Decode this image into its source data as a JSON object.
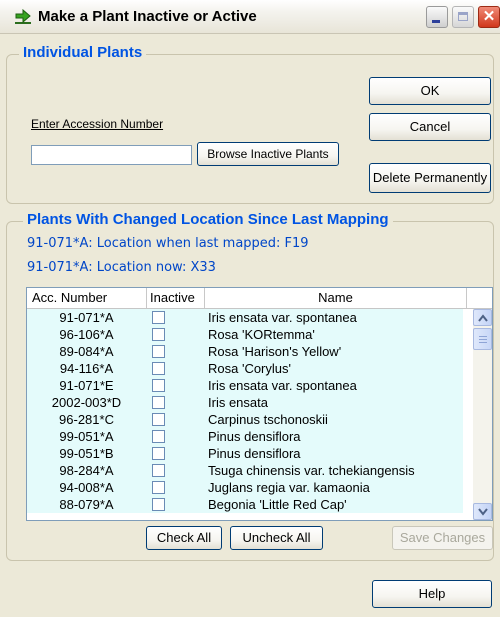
{
  "window": {
    "title": "Make a Plant Inactive or Active"
  },
  "individual": {
    "group_title": "Individual Plants",
    "accession_label": "Enter Accession Number",
    "accession_value": "",
    "browse_label": "Browse Inactive Plants",
    "ok_label": "OK",
    "cancel_label": "Cancel",
    "delete_label": "Delete Permanently"
  },
  "changed": {
    "group_title": "Plants With Changed Location Since Last Mapping",
    "line1": "91-071*A: Location when last mapped: F19",
    "line2": "91-071*A: Location now: X33",
    "columns": {
      "acc": "Acc. Number",
      "inactive": "Inactive",
      "name": "Name"
    },
    "rows": [
      {
        "acc": "91-071*A",
        "inactive": false,
        "name": "Iris ensata var. spontanea"
      },
      {
        "acc": "96-106*A",
        "inactive": false,
        "name": "Rosa 'KORtemma'"
      },
      {
        "acc": "89-084*A",
        "inactive": false,
        "name": "Rosa 'Harison's Yellow'"
      },
      {
        "acc": "94-116*A",
        "inactive": false,
        "name": "Rosa 'Corylus'"
      },
      {
        "acc": "91-071*E",
        "inactive": false,
        "name": "Iris ensata var. spontanea"
      },
      {
        "acc": "2002-003*D",
        "inactive": false,
        "name": "Iris ensata"
      },
      {
        "acc": "96-281*C",
        "inactive": false,
        "name": "Carpinus tschonoskii"
      },
      {
        "acc": "99-051*A",
        "inactive": false,
        "name": "Pinus densiflora"
      },
      {
        "acc": "99-051*B",
        "inactive": false,
        "name": "Pinus densiflora"
      },
      {
        "acc": "98-284*A",
        "inactive": false,
        "name": "Tsuga chinensis var. tchekiangensis"
      },
      {
        "acc": "94-008*A",
        "inactive": false,
        "name": "Juglans regia var. kamaonia"
      },
      {
        "acc": "88-079*A",
        "inactive": false,
        "name": "Begonia 'Little Red Cap'"
      }
    ],
    "check_all_label": "Check All",
    "uncheck_all_label": "Uncheck All",
    "save_label": "Save Changes"
  },
  "footer": {
    "help_label": "Help"
  },
  "icons": {
    "app": "green-arrow-icon",
    "minimize": "minimize-icon",
    "maximize": "maximize-icon",
    "close": "close-icon",
    "scroll_up": "scroll-up-arrow-icon",
    "scroll_down": "scroll-down-arrow-icon"
  },
  "colors": {
    "accent_text": "#0054E3",
    "row_background": "#E4FBFB",
    "window_background": "#ECE9D8"
  }
}
